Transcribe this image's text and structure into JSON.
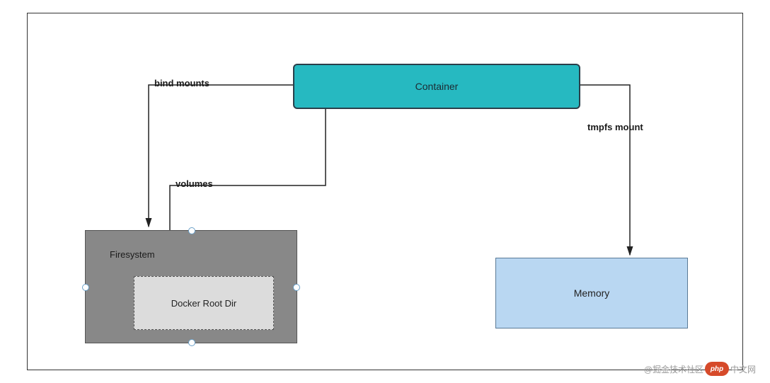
{
  "nodes": {
    "container": {
      "label": "Container"
    },
    "filesystem": {
      "label": "Firesystem"
    },
    "docker_root": {
      "label": "Docker Root Dir"
    },
    "memory": {
      "label": "Memory"
    }
  },
  "edges": {
    "bind_mounts": {
      "label": "bind mounts"
    },
    "volumes": {
      "label": "volumes"
    },
    "tmpfs": {
      "label": "tmpfs mount"
    }
  },
  "colors": {
    "container_bg": "#26b9c1",
    "container_border": "#2a3f4a",
    "filesystem_bg": "#888888",
    "docker_root_bg": "#dcdcdc",
    "memory_bg": "#b9d7f2"
  },
  "watermark": {
    "prefix": "@掘金技术社区",
    "badge": "php",
    "suffix": "中文网"
  }
}
